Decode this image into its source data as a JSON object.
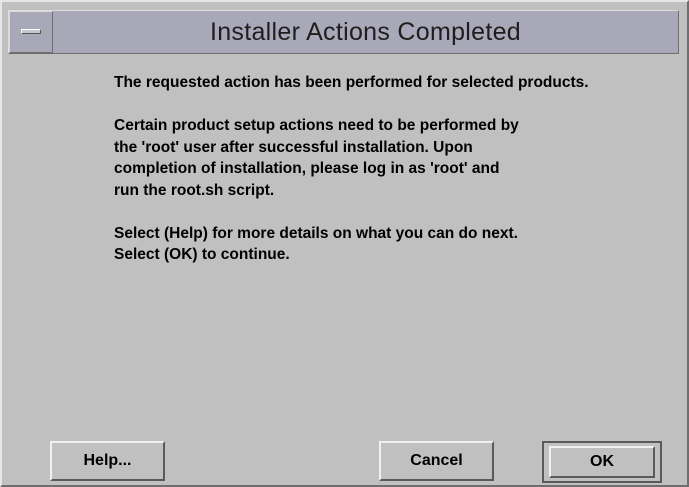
{
  "window": {
    "title": "Installer Actions Completed"
  },
  "message": {
    "paragraph1": "The requested action has been performed for selected products.",
    "paragraph2_line1": "Certain product setup actions need to be performed by",
    "paragraph2_line2": "the 'root' user after successful installation.  Upon",
    "paragraph2_line3": "completion of installation, please log in as 'root' and",
    "paragraph2_line4": "run the root.sh script.",
    "paragraph3_line1": "Select (Help) for more details on what you can do next.",
    "paragraph3_line2": "Select (OK) to continue."
  },
  "buttons": {
    "help_label": "Help...",
    "cancel_label": "Cancel",
    "ok_label": "OK"
  },
  "icons": {
    "window_menu": "window-menu-icon"
  },
  "colors": {
    "background": "#c0c0c0",
    "titlebar": "#a8a8b8",
    "text": "#000000"
  }
}
